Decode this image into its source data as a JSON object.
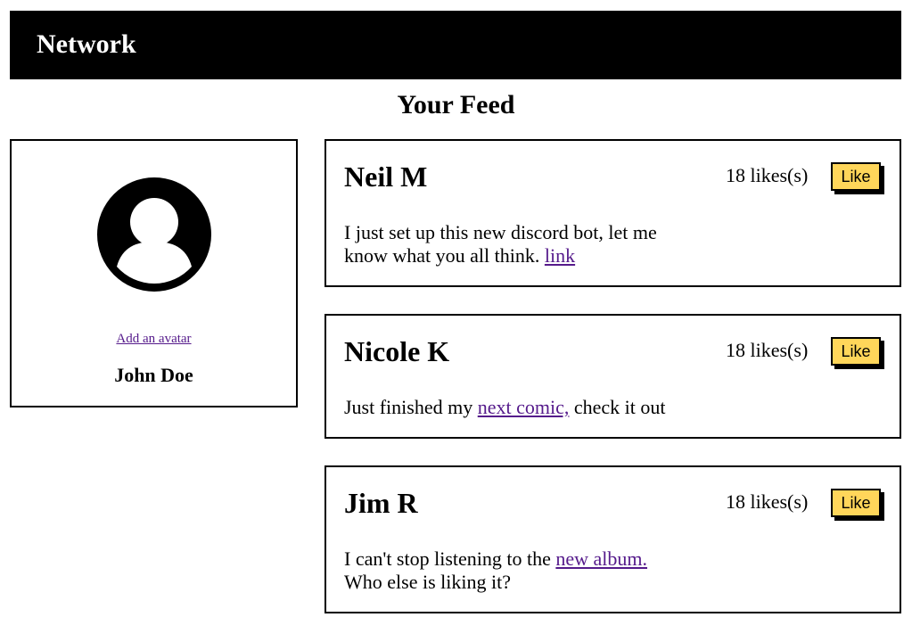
{
  "header": {
    "brand": "Network"
  },
  "feed": {
    "title": "Your Feed"
  },
  "profile": {
    "avatar_icon": "user-avatar-icon",
    "add_avatar_label": "Add an avatar",
    "name": "John Doe"
  },
  "posts": [
    {
      "author": "Neil M",
      "likes": "18 likes(s)",
      "like_label": "Like",
      "text_before": "I just set up this new discord bot, let me know what you all think. ",
      "link_text": "link",
      "text_after": ""
    },
    {
      "author": "Nicole K",
      "likes": "18 likes(s)",
      "like_label": "Like",
      "text_before": "Just finished my ",
      "link_text": "next comic,",
      "text_after": " check it out"
    },
    {
      "author": "Jim R",
      "likes": "18 likes(s)",
      "like_label": "Like",
      "text_before": "I can't stop listening to the ",
      "link_text": "new album.",
      "text_after": " Who else is liking it?"
    }
  ],
  "colors": {
    "header_bg": "#000000",
    "like_button_bg": "#ffd65a",
    "visited_link": "#551a8b"
  }
}
